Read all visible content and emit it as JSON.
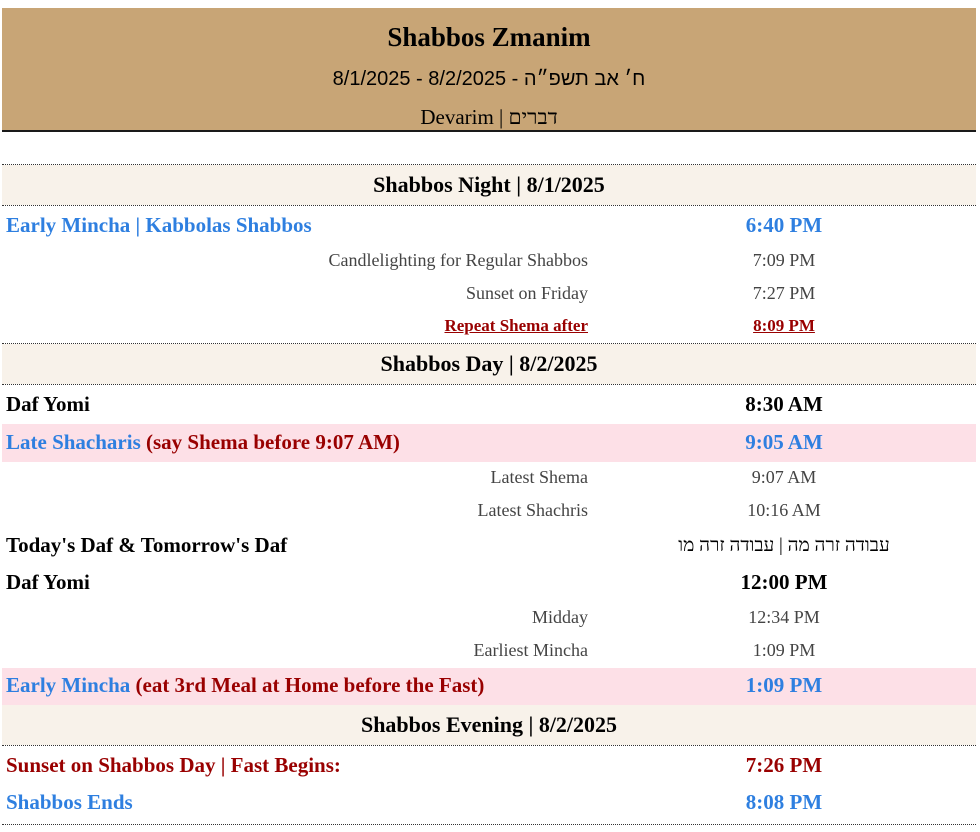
{
  "header": {
    "title": "Shabbos Zmanim",
    "dates": "8/1/2025 - 8/2/2025 - ח׳ אב תשפ״ה",
    "parsha": "Devarim | דברים"
  },
  "sections": {
    "night": "Shabbos Night | 8/1/2025",
    "day": "Shabbos Day | 8/2/2025",
    "evening": "Shabbos Evening | 8/2/2025"
  },
  "night": {
    "early_mincha_label": "Early Mincha | Kabbolas Shabbos",
    "early_mincha_time": "6:40 PM",
    "candle_label": "Candlelighting for Regular Shabbos",
    "candle_time": "7:09 PM",
    "sunset_label": "Sunset on Friday",
    "sunset_time": "7:27 PM",
    "repeat_shema_label": "Repeat Shema after",
    "repeat_shema_time": "8:09 PM"
  },
  "day": {
    "daf_yomi_label": "Daf Yomi",
    "daf_yomi_time": "8:30 AM",
    "late_shacharis_label": "Late Shacharis",
    "late_shacharis_note": "(say Shema before 9:07 AM)",
    "late_shacharis_time": "9:05 AM",
    "latest_shema_label": "Latest Shema",
    "latest_shema_time": "9:07 AM",
    "latest_shachris_label": "Latest Shachris",
    "latest_shachris_time": "10:16 AM",
    "todays_daf_label": "Today's Daf & Tomorrow's Daf",
    "todays_daf_value": "עבודה זרה מה | עבודה זרה מו",
    "daf_yomi2_label": "Daf Yomi",
    "daf_yomi2_time": "12:00 PM",
    "midday_label": "Midday",
    "midday_time": "12:34 PM",
    "earliest_mincha_label": "Earliest Mincha",
    "earliest_mincha_time": "1:09 PM",
    "early_mincha_label": "Early Mincha",
    "early_mincha_note": "(eat 3rd Meal at Home before the Fast)",
    "early_mincha_time": "1:09 PM"
  },
  "evening": {
    "sunset_label": "Sunset on Shabbos Day | Fast Begins:",
    "sunset_time": "7:26 PM",
    "ends_label": "Shabbos Ends",
    "ends_time": "8:08 PM"
  },
  "colors": {
    "header_bg": "#c8a576",
    "section_bg": "#f8f2ea",
    "highlight_bg": "#fde0e7",
    "blue": "#2e7fe0",
    "red": "#990000"
  }
}
